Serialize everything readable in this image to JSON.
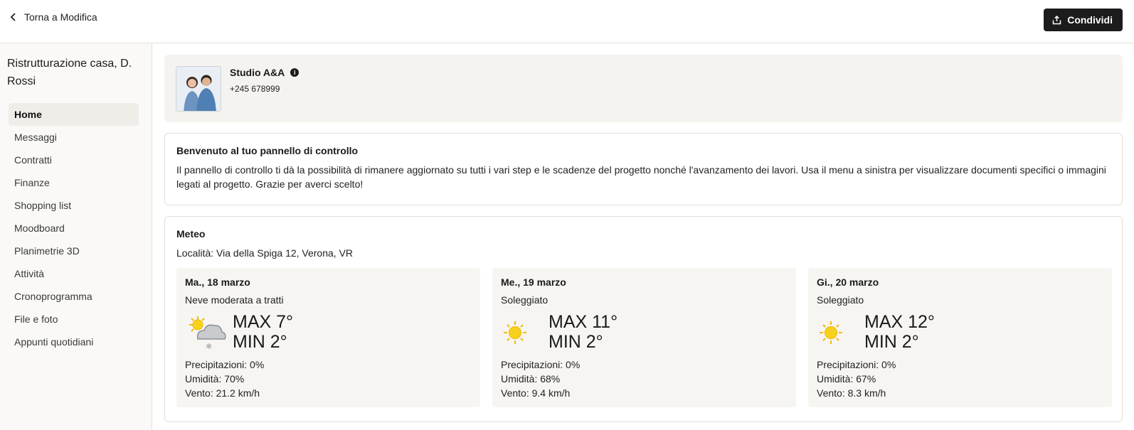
{
  "header": {
    "back_label": "Torna a Modifica",
    "share_label": "Condividi"
  },
  "sidebar": {
    "project_title": "Ristrutturazione casa, D. Rossi",
    "items": [
      {
        "label": "Home",
        "active": true
      },
      {
        "label": "Messaggi"
      },
      {
        "label": "Contratti"
      },
      {
        "label": "Finanze"
      },
      {
        "label": "Shopping list"
      },
      {
        "label": "Moodboard"
      },
      {
        "label": "Planimetrie 3D"
      },
      {
        "label": "Attività"
      },
      {
        "label": "Cronoprogramma"
      },
      {
        "label": "File e foto"
      },
      {
        "label": "Appunti quotidiani"
      }
    ]
  },
  "contact": {
    "name": "Studio A&A",
    "phone": "+245 678999"
  },
  "welcome": {
    "title": "Benvenuto al tuo pannello di controllo",
    "text": "Il pannello di controllo ti dà la possibilità di rimanere aggiornato su tutti i vari step e le scadenze del progetto nonché l'avanzamento dei lavori. Usa il menu a sinistra per visualizzare documenti specifici o immagini legati al progetto. Grazie per averci scelto!"
  },
  "weather": {
    "title": "Meteo",
    "location": "Località: Via della Spiga 12, Verona, VR",
    "days": [
      {
        "date": "Ma., 18 marzo",
        "condition": "Neve moderata a tratti",
        "icon": "snow-cloud-icon",
        "max": "MAX 7°",
        "min": "MIN 2°",
        "precip": "Precipitazioni: 0%",
        "humidity": "Umidità: 70%",
        "wind": "Vento: 21.2 km/h"
      },
      {
        "date": "Me., 19 marzo",
        "condition": "Soleggiato",
        "icon": "sun-icon",
        "max": "MAX 11°",
        "min": "MIN 2°",
        "precip": "Precipitazioni: 0%",
        "humidity": "Umidità: 68%",
        "wind": "Vento: 9.4 km/h"
      },
      {
        "date": "Gi., 20 marzo",
        "condition": "Soleggiato",
        "icon": "sun-icon",
        "max": "MAX 12°",
        "min": "MIN 2°",
        "precip": "Precipitazioni: 0%",
        "humidity": "Umidità: 67%",
        "wind": "Vento: 8.3 km/h"
      }
    ]
  },
  "colors": {
    "accent_dark": "#1c1c1c",
    "sun": "#f5b800",
    "border": "#e3e0d8"
  }
}
